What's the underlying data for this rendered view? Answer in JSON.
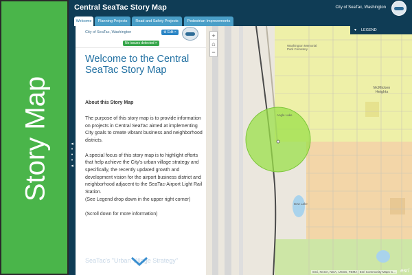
{
  "banner": {
    "text": "Story Map"
  },
  "header": {
    "title": "Central SeaTac Story Map",
    "city": "City of SeaTac, Washington"
  },
  "tabs": [
    {
      "label": "Welcome",
      "active": true
    },
    {
      "label": "Planning Projects",
      "active": false
    },
    {
      "label": "Road and Safety Projects",
      "active": false
    },
    {
      "label": "Pedestrian Improvements",
      "active": false
    }
  ],
  "panel": {
    "city": "City of SeaTac, Washington",
    "edit_label": "Edit",
    "issues_label": "No issues detected",
    "title": "Welcome to the Central SeaTac Story Map",
    "subtitle": "About this Story Map",
    "paragraphs": [
      "The purpose of this story map is to provide information on projects in Central SeaTac aimed at implementing City goals to create vibrant business and neighborhood districts.",
      "A special focus of this story map is to highlight efforts that help achieve the City's urban village strategy and specifically, the recently updated growth and development vision for the airport business district and neighborhood adjacent to the SeaTac-Airport Light Rail Station.",
      "(See Legend drop down in the upper right corner)",
      "(Scroll down for more information)"
    ],
    "next_heading": "SeaTac's \"Urban Village Strategy\""
  },
  "map": {
    "legend_label": "LEGEND",
    "zoom_in": "+",
    "home": "⌂",
    "zoom_out": "−",
    "attribution": "Esri, NASA, NGA, USGS, FEMA | Esri Community Maps C...",
    "esri": "esri",
    "labels": {
      "angle_lake": "Angle Lake",
      "mcmicken": "McMicken Heights",
      "washington_memorial": "Washington Memorial Park Cemetery",
      "bow_lake": "Bow Lake"
    },
    "colors": {
      "base": "#ebe7de",
      "zone_yellow": "#eef0a8",
      "zone_orange": "#f3d6a8",
      "zone_green": "#cde6a6",
      "circle": "#9be04a",
      "water": "#a9d3ec",
      "runway": "#d7d7d7"
    }
  }
}
